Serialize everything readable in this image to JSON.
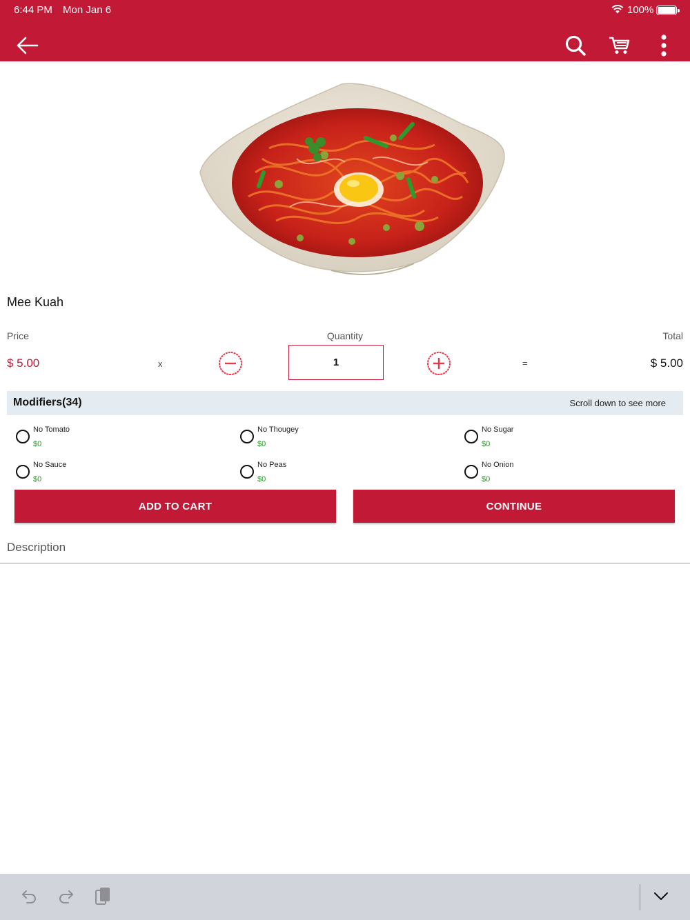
{
  "status_bar": {
    "time": "6:44 PM",
    "date": "Mon Jan 6",
    "battery": "100%"
  },
  "header": {
    "icons": [
      "back-arrow-icon",
      "search-icon",
      "cart-icon",
      "more-vertical-icon"
    ],
    "color": "#c21a36"
  },
  "product": {
    "name": "Mee Kuah",
    "image": "noodle-soup-dish-image"
  },
  "pricing": {
    "price_label": "Price",
    "quantity_label": "Quantity",
    "total_label": "Total",
    "price": "$ 5.00",
    "times": "x",
    "equals": "=",
    "quantity": "1",
    "total": "$ 5.00"
  },
  "modifiers": {
    "title": "Modifiers(34)",
    "hint": "Scroll down to see more",
    "items": [
      {
        "name": "No Tomato",
        "price": "$0"
      },
      {
        "name": "No Thougey",
        "price": "$0"
      },
      {
        "name": "No Sugar",
        "price": "$0"
      },
      {
        "name": "No Sauce",
        "price": "$0"
      },
      {
        "name": "No Peas",
        "price": "$0"
      },
      {
        "name": "No Onion",
        "price": "$0"
      }
    ]
  },
  "actions": {
    "add_to_cart": "ADD TO CART",
    "continue": "CONTINUE"
  },
  "description": {
    "label": "Description"
  },
  "keyboard_bar": {
    "icons": [
      "undo-icon",
      "redo-icon",
      "paste-icon",
      "dismiss-keyboard-icon"
    ]
  }
}
